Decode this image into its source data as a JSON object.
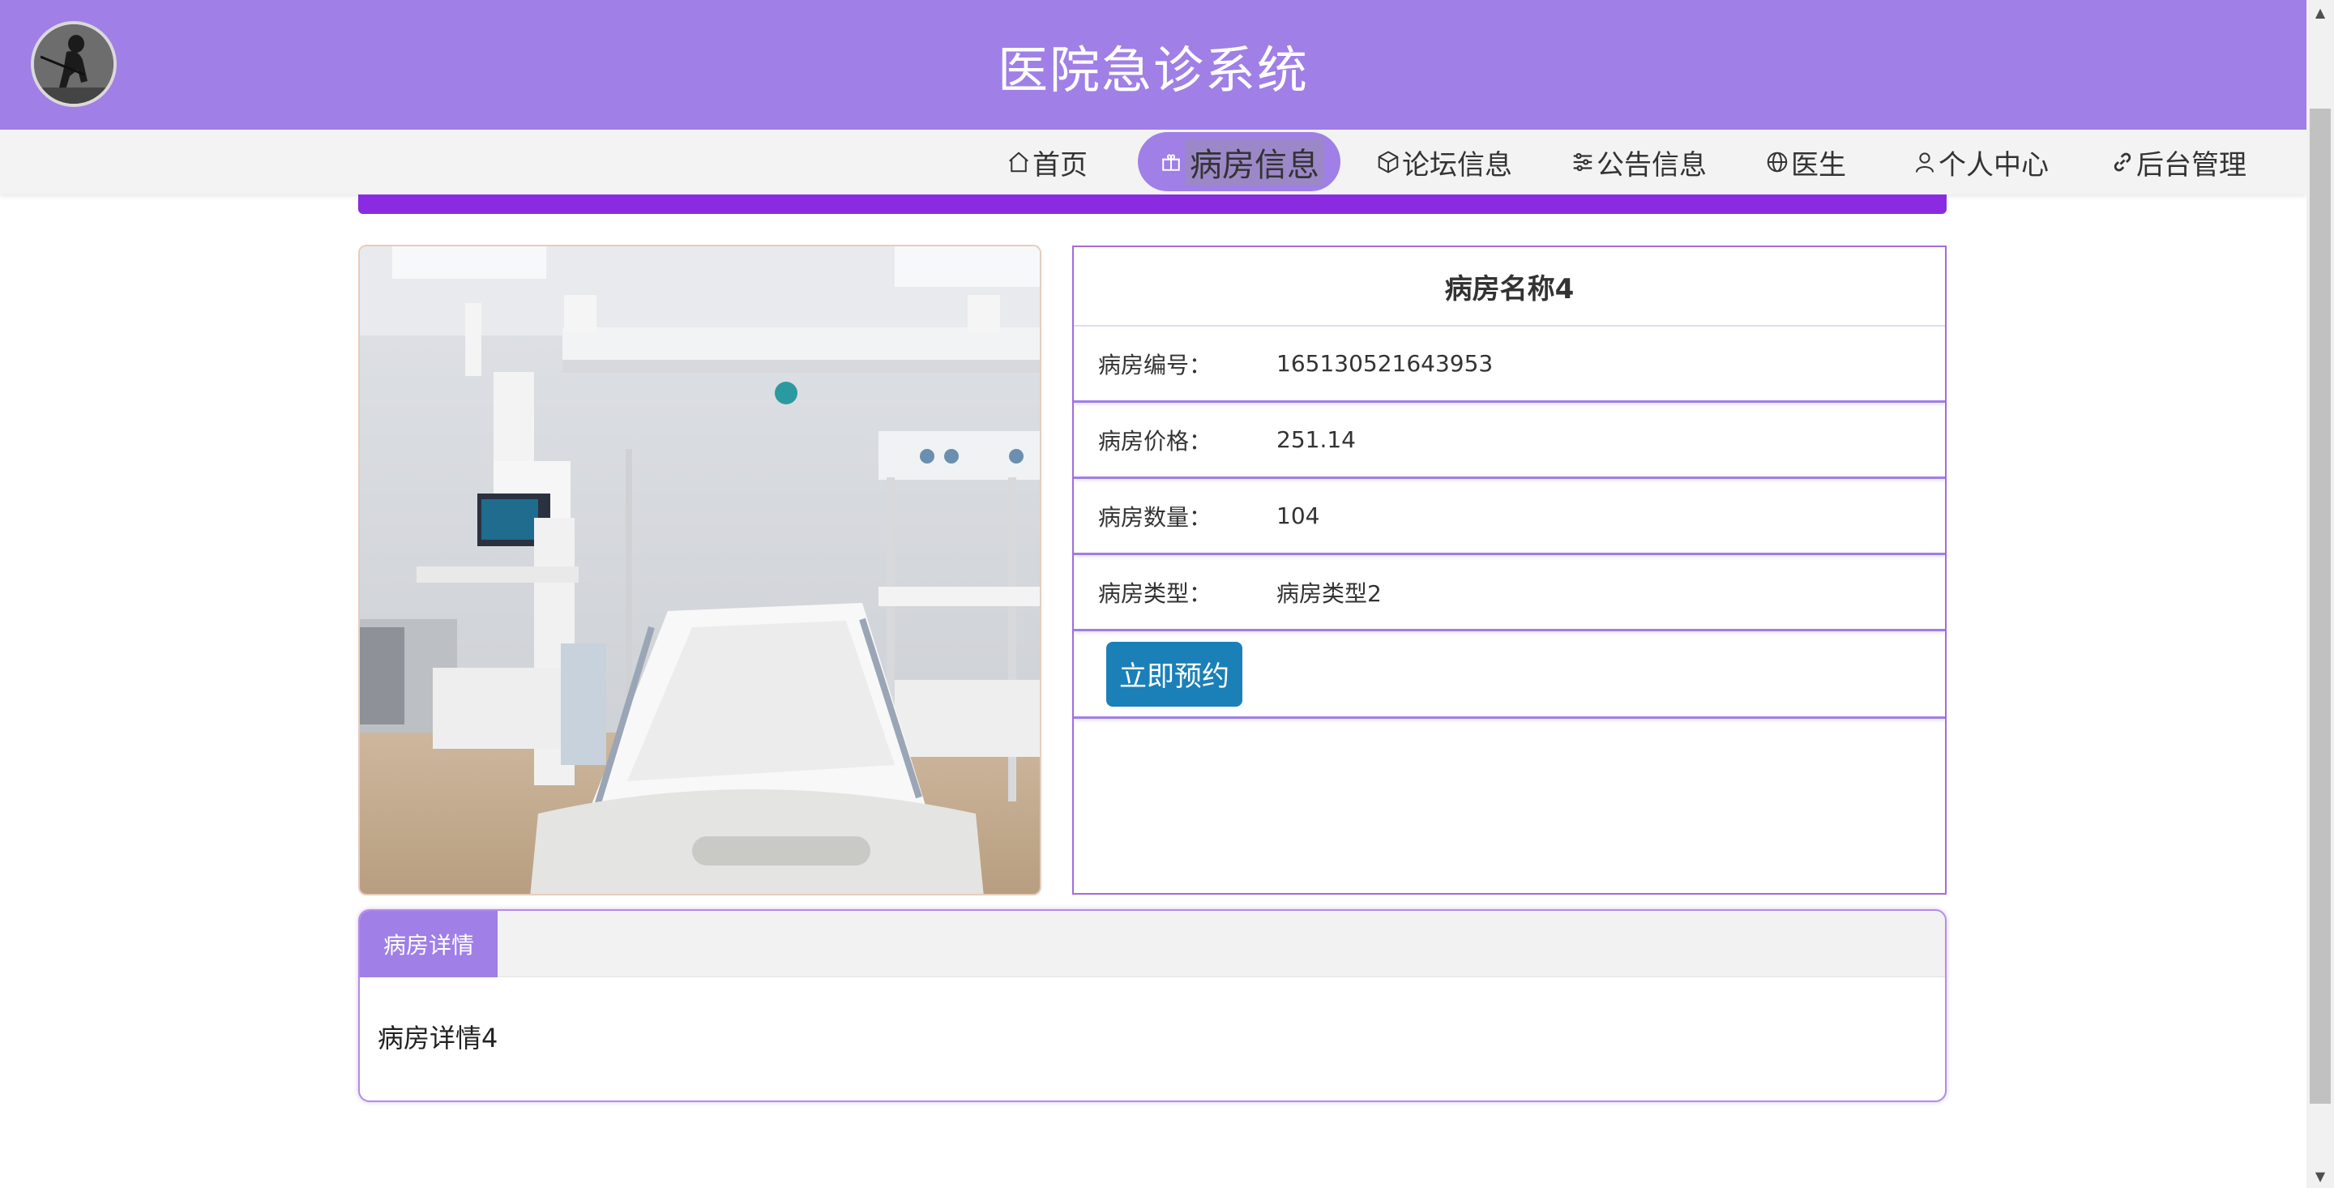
{
  "header": {
    "title": "医院急诊系统",
    "logo_icon": "avatar-silhouette-icon"
  },
  "nav": {
    "items": [
      {
        "label": "首页",
        "icon": "home-icon"
      },
      {
        "label": "病房信息",
        "icon": "gift-icon",
        "active": true
      },
      {
        "label": "论坛信息",
        "icon": "cube-icon"
      },
      {
        "label": "公告信息",
        "icon": "sliders-icon"
      },
      {
        "label": "医生",
        "icon": "globe-icon"
      },
      {
        "label": "个人中心",
        "icon": "user-icon"
      },
      {
        "label": "后台管理",
        "icon": "link-icon"
      }
    ]
  },
  "room": {
    "name": "病房名称4",
    "fields": [
      {
        "label": "病房编号：",
        "value": "165130521643953"
      },
      {
        "label": "病房价格：",
        "value": "251.14"
      },
      {
        "label": "病房数量：",
        "value": "104"
      },
      {
        "label": "病房类型：",
        "value": "病房类型2"
      }
    ],
    "reserve_label": "立即预约"
  },
  "detail": {
    "tab_label": "病房详情",
    "content": "病房详情4"
  },
  "colors": {
    "header_bg": "#a07fe6",
    "accent_strip": "#8a2be2",
    "button_bg": "#1b80b8",
    "panel_border": "#a46bd9"
  }
}
